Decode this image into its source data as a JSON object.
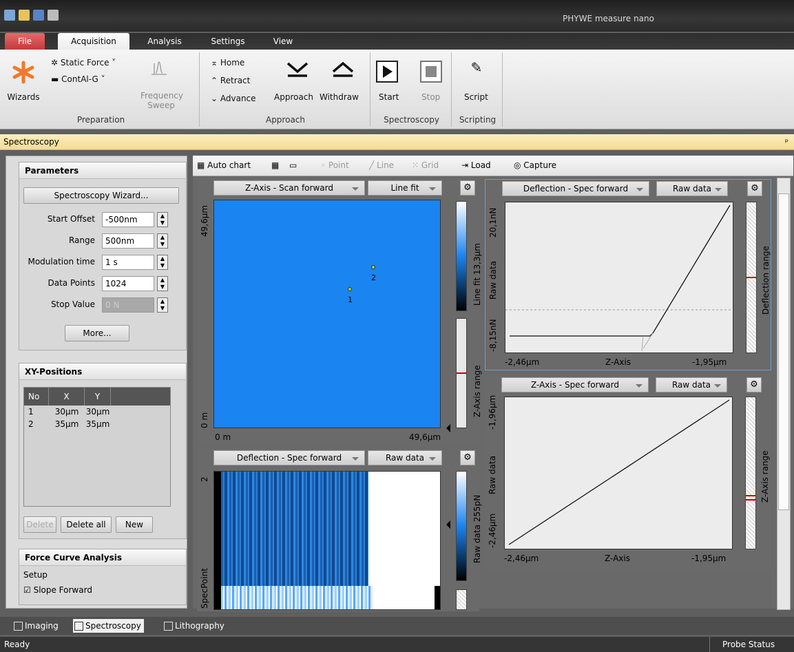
{
  "app_title": "PHYWE measure nano",
  "tabs": {
    "file": "File",
    "acquisition": "Acquisition",
    "analysis": "Analysis",
    "settings": "Settings",
    "view": "View"
  },
  "ribbon": {
    "wizards": "Wizards",
    "static_force": "Static Force",
    "contal": "ContAl-G",
    "freq_sweep_1": "Frequency",
    "freq_sweep_2": "Sweep",
    "home": "Home",
    "retract": "Retract",
    "advance": "Advance",
    "approach": "Approach",
    "withdraw": "Withdraw",
    "start": "Start",
    "stop": "Stop",
    "script": "Script",
    "group_preparation": "Preparation",
    "group_approach": "Approach",
    "group_spectroscopy": "Spectroscopy",
    "group_scripting": "Scripting"
  },
  "dock_title": "Spectroscopy",
  "parameters": {
    "header": "Parameters",
    "wizard_button": "Spectroscopy Wizard...",
    "fields": [
      {
        "label": "Start Offset",
        "value": "-500nm"
      },
      {
        "label": "Range",
        "value": "500nm"
      },
      {
        "label": "Modulation time",
        "value": "1 s"
      },
      {
        "label": "Data Points",
        "value": "1024"
      },
      {
        "label": "Stop Value",
        "value": "0 N"
      }
    ],
    "more_button": "More..."
  },
  "xy_positions": {
    "header": "XY-Positions",
    "columns": [
      "No",
      "X",
      "Y"
    ],
    "rows": [
      [
        "1",
        "30µm",
        "30µm"
      ],
      [
        "2",
        "35µm",
        "35µm"
      ]
    ],
    "delete": "Delete",
    "delete_all": "Delete all",
    "new": "New"
  },
  "force_curve": {
    "header": "Force Curve Analysis",
    "setup": "Setup",
    "slope_forward": "Slope Forward"
  },
  "toolbar": {
    "auto_chart": "Auto chart",
    "point": "Point",
    "line": "Line",
    "grid": "Grid",
    "load": "Load",
    "capture": "Capture"
  },
  "charts": {
    "image": {
      "signal": "Z-Axis - Scan forward",
      "filter": "Line fit",
      "y_top": "49,6µm",
      "y_bottom": "0 m",
      "x_left": "0 m",
      "x_right": "49,6µm",
      "colorbar": "Line fit 13,3µm",
      "range_label": "Z-Axis range",
      "points": [
        {
          "label": "1"
        },
        {
          "label": "2"
        }
      ]
    },
    "deflection_plot": {
      "signal": "Deflection - Spec forward",
      "filter": "Raw data",
      "y_top": "20,1nN",
      "y_mid": "Raw data",
      "y_bottom": "-8,15nN",
      "x_left": "-2,46µm",
      "x_mid": "Z-Axis",
      "x_right": "-1,95µm",
      "range_label": "Deflection range"
    },
    "zaxis_plot": {
      "signal": "Z-Axis - Spec forward",
      "filter": "Raw data",
      "y_top": "-1,96µm",
      "y_mid": "Raw data",
      "y_bottom": "-2,46µm",
      "x_left": "-2,46µm",
      "x_mid": "Z-Axis",
      "x_right": "-1,95µm",
      "range_label": "Z-Axis range"
    },
    "spec_map": {
      "signal": "Deflection - Spec forward",
      "filter": "Raw data",
      "y_top": "2",
      "y_bottom": "SpecPoint",
      "colorbar": "Raw data 255pN"
    }
  },
  "bottom_tabs": {
    "imaging": "Imaging",
    "spectroscopy": "Spectroscopy",
    "lithography": "Lithography"
  },
  "status": {
    "left": "Ready",
    "right": "Probe Status"
  }
}
